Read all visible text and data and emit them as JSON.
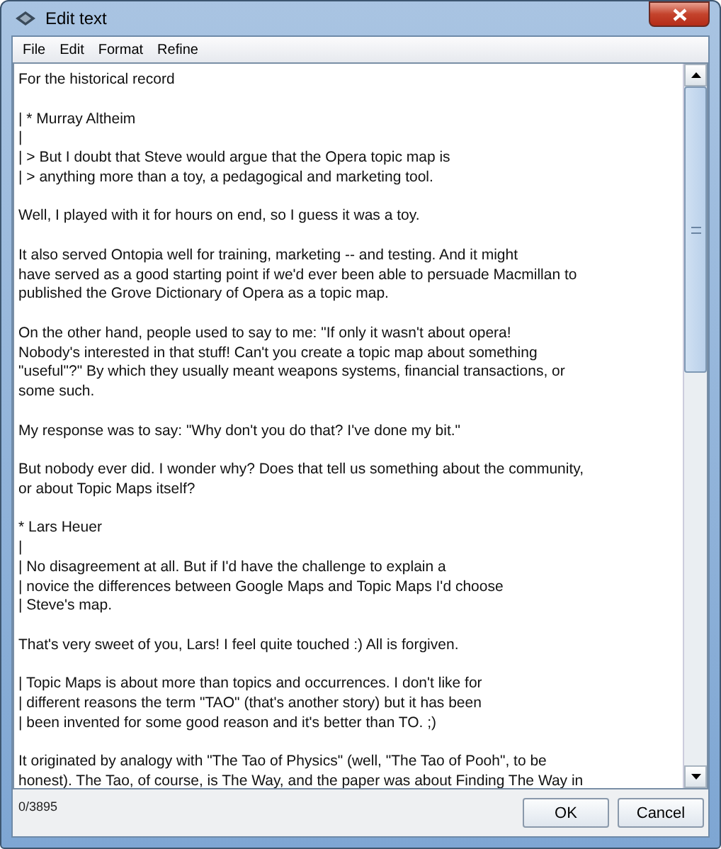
{
  "window": {
    "title": "Edit text"
  },
  "menu": [
    "File",
    "Edit",
    "Format",
    "Refine"
  ],
  "editor": {
    "paragraphs": [
      [
        "For the historical record"
      ],
      [
        "| * Murray Altheim",
        "|",
        "| > But I doubt that Steve would argue that the Opera topic map is",
        "| > anything more than a toy, a pedagogical and marketing tool."
      ],
      [
        "Well, I played with it for hours on end, so I guess it was a toy."
      ],
      [
        "It also served Ontopia well for training, marketing -- and testing. And it might",
        "have served as a good starting point if we'd ever been able to persuade Macmillan to",
        "published the Grove Dictionary of Opera as a topic map."
      ],
      [
        "On the other hand, people used to say to me: \"If only it wasn't about opera!",
        "Nobody's interested in that stuff! Can't you create a topic map about something",
        "\"useful\"?\" By which they usually meant weapons systems, financial transactions, or",
        "some such."
      ],
      [
        "My response was to say: \"Why don't you do that? I've done my bit.\""
      ],
      [
        "But nobody ever did. I wonder why? Does that tell us something about the community,",
        "or about Topic Maps itself?"
      ],
      [
        "* Lars Heuer",
        "|",
        "| No disagreement at all. But if I'd have the challenge to explain a",
        "| novice the differences between Google Maps and Topic Maps I'd choose",
        "| Steve's map."
      ],
      [
        "That's very sweet of you, Lars! I feel quite touched :) All is forgiven."
      ],
      [
        "| Topic Maps is about more than topics and occurrences. I don't like for",
        "| different reasons the term \"TAO\" (that's another story) but it has been",
        "| been invented for some good reason and it's better than TO. ;)"
      ],
      [
        "It originated by analogy with \"The Tao of Physics\" (well, \"The Tao of Pooh\", to be",
        "honest). The Tao, of course, is The Way, and the paper was about Finding The Way in"
      ]
    ]
  },
  "status": "0/3895",
  "buttons": [
    "OK",
    "Cancel"
  ]
}
